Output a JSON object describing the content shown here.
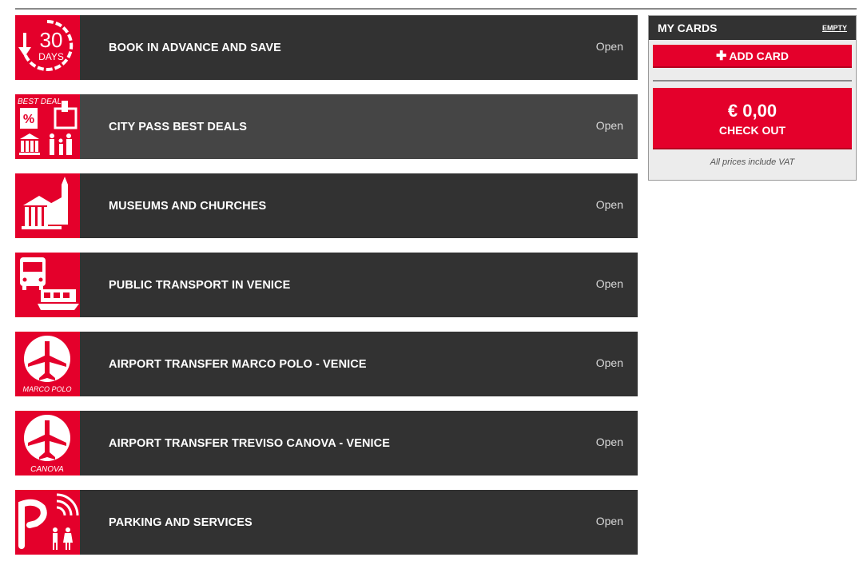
{
  "categories": [
    {
      "title": "BOOK IN ADVANCE AND SAVE",
      "action": "Open",
      "icon": "calendar-30-days-icon",
      "icon_text": "30",
      "icon_subtext": "DAYS"
    },
    {
      "title": "CITY PASS BEST DEALS",
      "action": "Open",
      "icon": "best-deal-icon",
      "icon_text": "BEST DEAL"
    },
    {
      "title": "MUSEUMS AND CHURCHES",
      "action": "Open",
      "icon": "museum-church-icon"
    },
    {
      "title": "PUBLIC TRANSPORT IN VENICE",
      "action": "Open",
      "icon": "bus-boat-icon"
    },
    {
      "title": "AIRPORT TRANSFER MARCO POLO - VENICE",
      "action": "Open",
      "icon": "airplane-marco-polo-icon",
      "icon_text": "MARCO POLO"
    },
    {
      "title": "AIRPORT TRANSFER TREVISO CANOVA - VENICE",
      "action": "Open",
      "icon": "airplane-canova-icon",
      "icon_text": "CANOVA"
    },
    {
      "title": "PARKING AND SERVICES",
      "action": "Open",
      "icon": "parking-wifi-icon"
    }
  ],
  "cart": {
    "title": "MY CARDS",
    "empty_label": "EMPTY",
    "add_card_label": "ADD CARD",
    "total": "€ 0,00",
    "checkout_label": "CHECK OUT",
    "vat_note": "All prices include VAT"
  },
  "colors": {
    "brand_red": "#e4002b",
    "row_dark": "#323232",
    "row_active": "#454545"
  }
}
